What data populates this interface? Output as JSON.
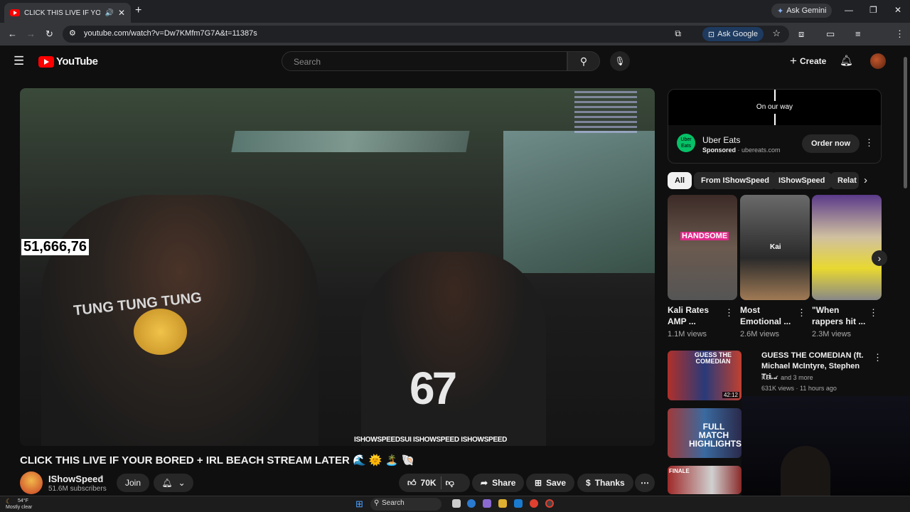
{
  "browser": {
    "tab_title": "CLICK THIS LIVE IF YOUR BORED",
    "new_tab": "+",
    "ask_gemini": "Ask Gemini",
    "url": "youtube.com/watch?v=Dw7KMfm7G7A&t=11387s",
    "ask_google": "Ask Google"
  },
  "youtube": {
    "logo": "YouTube",
    "search_placeholder": "Search",
    "create": "Create"
  },
  "video": {
    "counter": "51,666,76",
    "shirt_text": "TUNG TUNG TUNG",
    "shirt_number": "67",
    "socials": "ISHOWSPEEDSUI  ISHOWSPEED  ISHOWSPEED",
    "title": "CLICK THIS LIVE IF YOUR BORED + IRL BEACH STREAM LATER 🌊 🌞 🏝️ 🐚"
  },
  "channel": {
    "name": "IShowSpeed",
    "subscribers": "51.6M subscribers",
    "join": "Join"
  },
  "actions": {
    "likes": "70K",
    "share": "Share",
    "save": "Save",
    "thanks": "Thanks"
  },
  "ad": {
    "banner": "On our way",
    "logo_text": "Uber Eats",
    "name": "Uber Eats",
    "sponsored": "Sponsored",
    "domain": "· ubereats.com",
    "cta": "Order now"
  },
  "chips": [
    "All",
    "From IShowSpeed",
    "IShowSpeed",
    "Relat"
  ],
  "shorts": [
    {
      "title": "Kali Rates AMP ...",
      "views": "1.1M views",
      "overlay": "HANDSOME"
    },
    {
      "title": "Most Emotional ...",
      "views": "2.6M views",
      "overlay": "Kai"
    },
    {
      "title": "\"When rappers hit ...",
      "views": "2.3M views",
      "overlay": ""
    }
  ],
  "videos": [
    {
      "title": "GUESS THE COMEDIAN (ft. Michael McIntyre, Stephen Tri...",
      "channel": "KSI",
      "extra": "and 3 more",
      "meta": "631K views · 11 hours ago",
      "thumb_text": "GUESS THE COMEDIAN",
      "duration": "42:12"
    },
    {
      "title": "",
      "channel": "",
      "extra": "",
      "meta": "",
      "thumb_text": "FULL MATCH HIGHLIGHTS",
      "duration": ""
    },
    {
      "title": "",
      "channel": "",
      "extra": "",
      "meta": "",
      "thumb_text": "FINALE",
      "duration": ""
    }
  ],
  "taskbar": {
    "temp": "54°F",
    "weather": "Mostly clear",
    "search": "Search"
  },
  "colors": {
    "youtube_red": "#ff0000",
    "uber_green": "#06c167",
    "background": "#0f0f0f"
  }
}
